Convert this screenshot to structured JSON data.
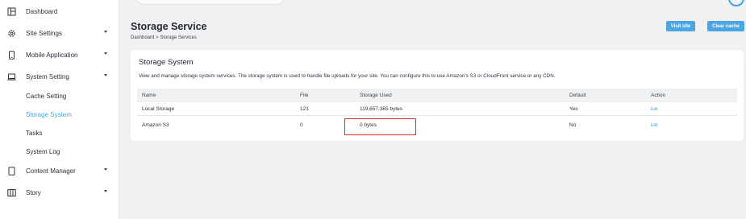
{
  "sidebar": {
    "items": [
      {
        "label": "Dashboard",
        "icon": "dashboard-icon",
        "has_chevron": false
      },
      {
        "label": "Site Settings",
        "icon": "gear-icon",
        "has_chevron": true
      },
      {
        "label": "Mobile Application",
        "icon": "mobile-icon",
        "has_chevron": true
      },
      {
        "label": "System Setting",
        "icon": "laptop-icon",
        "has_chevron": true
      },
      {
        "label": "Cache Setting"
      },
      {
        "label": "Storage System",
        "active": true
      },
      {
        "label": "Tasks"
      },
      {
        "label": "System Log"
      },
      {
        "label": "Content Manager",
        "icon": "tablet-icon",
        "has_chevron": true
      },
      {
        "label": "Story",
        "icon": "columns-icon",
        "has_chevron": true
      }
    ],
    "active_color": "#4ea6dc"
  },
  "header": {
    "title": "Storage Service",
    "breadcrumb": "Dashboard  >  Storage Services",
    "visit_site_label": "Visit site",
    "clear_cache_label": "Clear cache",
    "button_color": "#49a6e3"
  },
  "card": {
    "title": "Storage System",
    "description": "View and manage storage system services. The storage system is used to handle file uploads for your site. You can configure this to use Amazon's S3 or CloudFront service or any CDN."
  },
  "table": {
    "headers": {
      "name": "Name",
      "file": "File",
      "used": "Storage Used",
      "default": "Default",
      "action": "Action"
    },
    "rows": [
      {
        "name": "Local Storage",
        "file": "121",
        "used": "119,657,365 bytes",
        "default": "Yes",
        "action": "Edit"
      },
      {
        "name": "Amazon S3",
        "file": "0",
        "used": "0 bytes",
        "default": "No",
        "action": "Edit"
      }
    ]
  },
  "highlight_color": "#e02b2b"
}
